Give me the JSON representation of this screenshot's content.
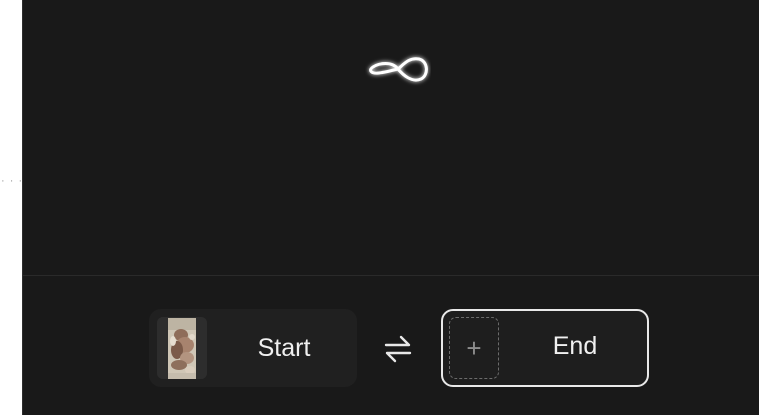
{
  "sidebar": {
    "more_dots": "· · ·"
  },
  "loader": {
    "icon": "infinity-icon"
  },
  "frames": {
    "start_label": "Start",
    "end_label": "End",
    "add_icon": "plus-icon",
    "swap_icon": "swap-arrows-icon"
  },
  "colors": {
    "background": "#191919",
    "card": "#202020",
    "text": "#f0f0f0",
    "border_active": "#e9e9e9"
  }
}
